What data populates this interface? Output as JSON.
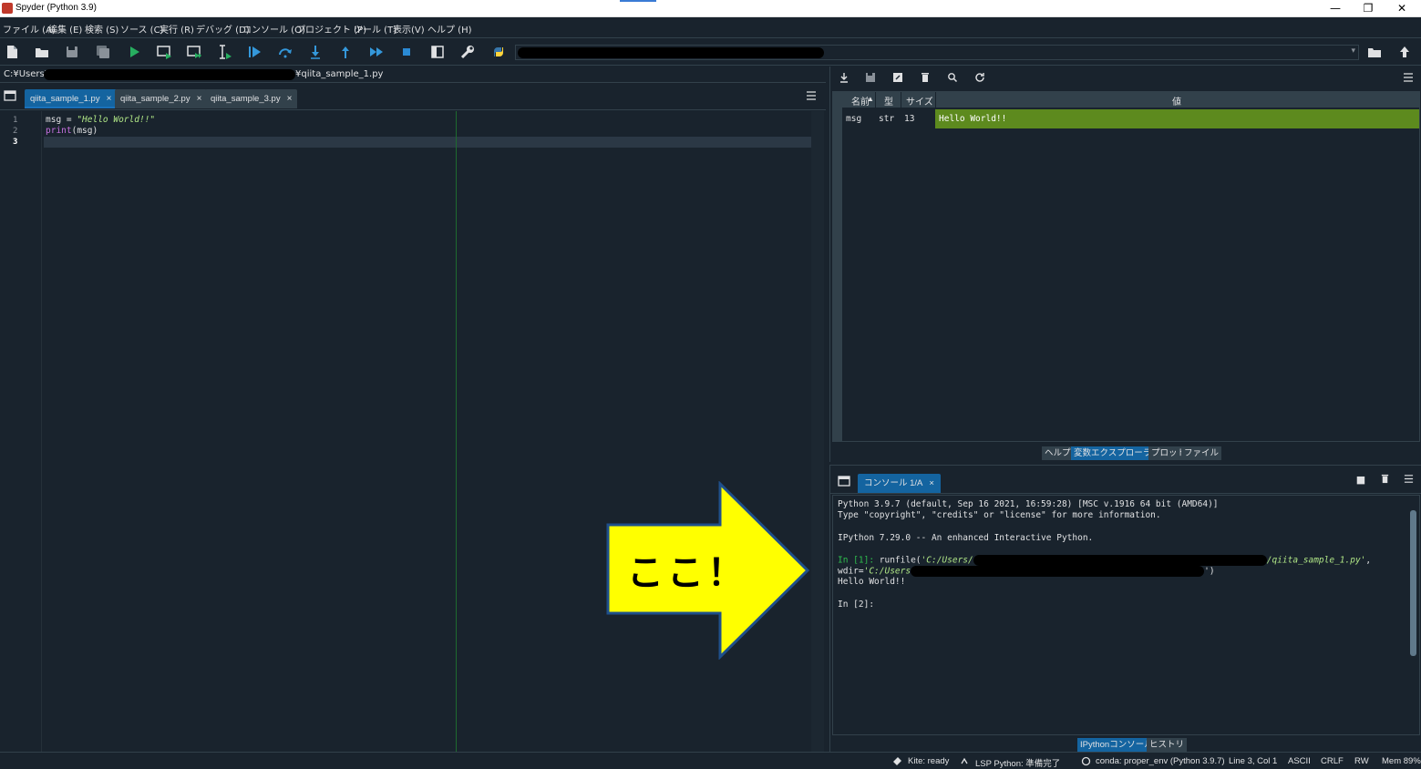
{
  "window": {
    "title": "Spyder (Python 3.9)",
    "controls": {
      "minimize": "—",
      "restore": "❐",
      "close": "✕"
    }
  },
  "menu": {
    "items": [
      "ファイル (A)",
      "編集 (E)",
      "検索 (S)",
      "ソース (C)",
      "実行 (R)",
      "デバッグ (D)",
      "コンソール (O)",
      "プロジェクト (P)",
      "ツール (T)",
      "表示(V)",
      "ヘルプ (H)"
    ]
  },
  "toolbar": {
    "icons": [
      "new-file-icon",
      "open-file-icon",
      "save-icon",
      "save-all-icon",
      "run-icon",
      "run-cell-icon",
      "run-cell-advance-icon",
      "run-selection-icon",
      "debug-icon",
      "step-over-icon",
      "step-into-icon",
      "step-return-icon",
      "continue-icon",
      "stop-icon",
      "maximize-pane-icon",
      "preferences-icon",
      "python-path-icon"
    ],
    "colors": {
      "run": "#27ae60",
      "debug": "#3498db",
      "stop": "#2a8ad4"
    }
  },
  "editor": {
    "path_prefix": "C:¥Users¥",
    "path_suffix": "¥qiita_sample_1.py",
    "tabs": [
      {
        "label": "qiita_sample_1.py",
        "active": true
      },
      {
        "label": "qiita_sample_2.py",
        "active": false
      },
      {
        "label": "qiita_sample_3.py",
        "active": false
      }
    ],
    "tab_close": "×",
    "line_numbers": [
      "1",
      "2",
      "3"
    ],
    "code": {
      "line1_var": "msg = ",
      "line1_str": "\"Hello World!!\"",
      "line2_fn": "print",
      "line2_rest": "(msg)"
    }
  },
  "variable_explorer": {
    "columns": {
      "name": "名前",
      "type": "型",
      "size": "サイズ",
      "value": "値"
    },
    "rows": [
      {
        "name": "msg",
        "type": "str",
        "size": "13",
        "value": "Hello World!!"
      }
    ],
    "pane_tabs": [
      {
        "label": "ヘルプ",
        "active": false
      },
      {
        "label": "変数エクスプローラー",
        "active": true
      },
      {
        "label": "プロット",
        "active": false
      },
      {
        "label": "ファイル",
        "active": false
      }
    ]
  },
  "console": {
    "tab_label": "コンソール 1/A",
    "tab_close": "×",
    "lines": {
      "l1": "Python 3.9.7 (default, Sep 16 2021, 16:59:28) [MSC v.1916 64 bit (AMD64)]",
      "l2": "Type \"copyright\", \"credits\" or \"license\" for more information.",
      "l3": "IPython 7.29.0 -- An enhanced Interactive Python.",
      "in1_prompt": "In [1]: ",
      "in1_cmd": "runfile(",
      "in1_str1": "'C:/Users/",
      "in1_str2": "/qiita_sample_1.py'",
      "in1_comma": ",",
      "wdir_label": "wdir=",
      "wdir_str": "'C:/Users",
      "wdir_end": "')",
      "output": "Hello World!!",
      "in2_prompt": "In [2]:"
    },
    "pane_tabs": [
      {
        "label": "IPythonコンソール",
        "active": true
      },
      {
        "label": "ヒストリ",
        "active": false
      }
    ]
  },
  "callout": {
    "text": "ここ！",
    "fill": "#ffff00",
    "stroke": "#1e4f8a"
  },
  "status": {
    "kite": "Kite: ready",
    "lsp": "LSP Python: 準備完了",
    "conda": "conda: proper_env (Python 3.9.7)",
    "position": "Line 3, Col 1",
    "encoding": "ASCII",
    "eol": "CRLF",
    "mode": "RW",
    "mem": "Mem 89%"
  }
}
